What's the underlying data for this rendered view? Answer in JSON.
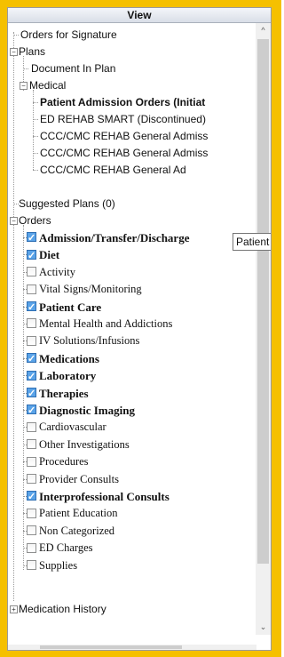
{
  "panel": {
    "title": "View"
  },
  "tooltip": "Patient A",
  "tree": {
    "orders_for_signature": "Orders for Signature",
    "plans": "Plans",
    "document_in_plan": "Document In Plan",
    "medical": "Medical",
    "plan_items": [
      {
        "label": "Patient Admission Orders (Initiat",
        "bold": true
      },
      {
        "label": "ED REHAB SMART (Discontinued)",
        "bold": false
      },
      {
        "label": "CCC/CMC REHAB General Admiss",
        "bold": false
      },
      {
        "label": "CCC/CMC REHAB General Admiss",
        "bold": false
      },
      {
        "label": "CCC/CMC REHAB General Ad",
        "bold": false
      }
    ],
    "suggested_plans": "Suggested Plans (0)",
    "orders": "Orders",
    "order_items": [
      {
        "label": "Admission/Transfer/Discharge",
        "checked": true
      },
      {
        "label": "Diet",
        "checked": true
      },
      {
        "label": "Activity",
        "checked": false
      },
      {
        "label": "Vital Signs/Monitoring",
        "checked": false
      },
      {
        "label": "Patient Care",
        "checked": true
      },
      {
        "label": "Mental Health and Addictions",
        "checked": false
      },
      {
        "label": "IV Solutions/Infusions",
        "checked": false
      },
      {
        "label": "Medications",
        "checked": true
      },
      {
        "label": "Laboratory",
        "checked": true
      },
      {
        "label": "Therapies",
        "checked": true
      },
      {
        "label": "Diagnostic Imaging",
        "checked": true
      },
      {
        "label": "Cardiovascular",
        "checked": false
      },
      {
        "label": "Other Investigations",
        "checked": false
      },
      {
        "label": "Procedures",
        "checked": false
      },
      {
        "label": "Provider Consults",
        "checked": false
      },
      {
        "label": "Interprofessional Consults",
        "checked": true
      },
      {
        "label": "Patient Education",
        "checked": false
      },
      {
        "label": "Non Categorized",
        "checked": false
      },
      {
        "label": "ED Charges",
        "checked": false
      },
      {
        "label": "Supplies",
        "checked": false
      }
    ],
    "medication_history": "Medication History"
  }
}
